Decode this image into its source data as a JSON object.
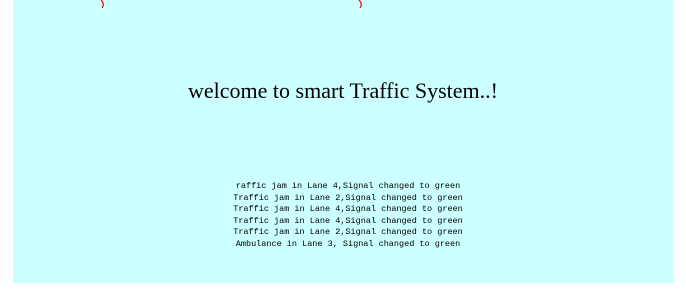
{
  "page": {
    "title": "welcome to smart Traffic System..!",
    "background_color": "#ccffff",
    "accent_color": "#ff0000"
  },
  "log_messages": [
    "raffic jam in Lane 4,Signal changed to green",
    "Traffic jam in Lane 2,Signal changed to green",
    "Traffic jam in Lane 4,Signal changed to green",
    "Traffic jam in Lane 4,Signal changed to green",
    "Traffic jam in Lane 2,Signal changed to green",
    "Ambulance in Lane 3, Signal changed to green"
  ]
}
